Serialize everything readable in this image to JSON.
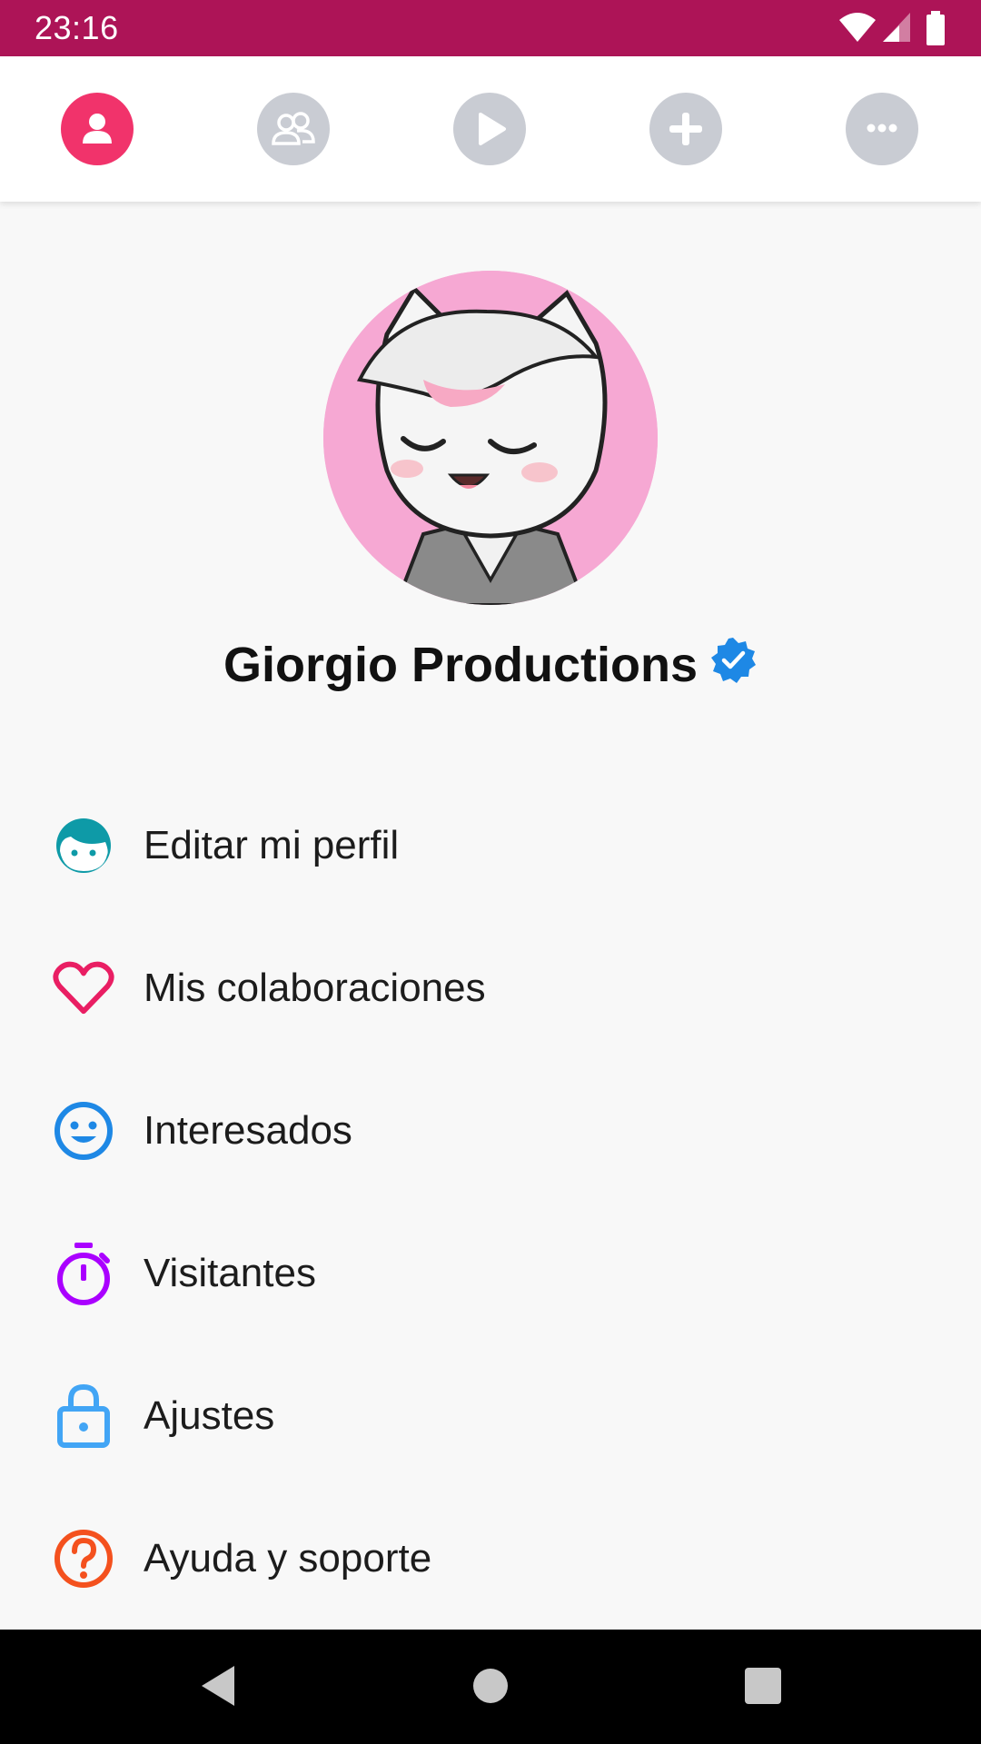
{
  "status": {
    "time": "23:16"
  },
  "topnav": {
    "tabs": [
      {
        "icon": "profile-icon",
        "active": true
      },
      {
        "icon": "people-icon",
        "active": false
      },
      {
        "icon": "play-icon",
        "active": false
      },
      {
        "icon": "plus-icon",
        "active": false
      },
      {
        "icon": "chat-icon",
        "active": false
      }
    ]
  },
  "profile": {
    "name": "Giorgio Productions",
    "verified": true
  },
  "menu": {
    "items": [
      {
        "label": "Editar mi perfil",
        "icon": "face-icon",
        "color": "#0e9aa7"
      },
      {
        "label": "Mis colaboraciones",
        "icon": "heart-icon",
        "color": "#e91e63"
      },
      {
        "label": "Interesados",
        "icon": "smiley-icon",
        "color": "#1e88e5"
      },
      {
        "label": "Visitantes",
        "icon": "stopwatch-icon",
        "color": "#aa00ff"
      },
      {
        "label": "Ajustes",
        "icon": "lock-icon",
        "color": "#42a5f5"
      },
      {
        "label": "Ayuda y soporte",
        "icon": "help-icon",
        "color": "#f4511e"
      }
    ]
  },
  "colors": {
    "statusbar": "#ad1457",
    "active_tab": "#f1336b",
    "inactive_tab": "#c9ccd3",
    "verified": "#1e88e5"
  }
}
